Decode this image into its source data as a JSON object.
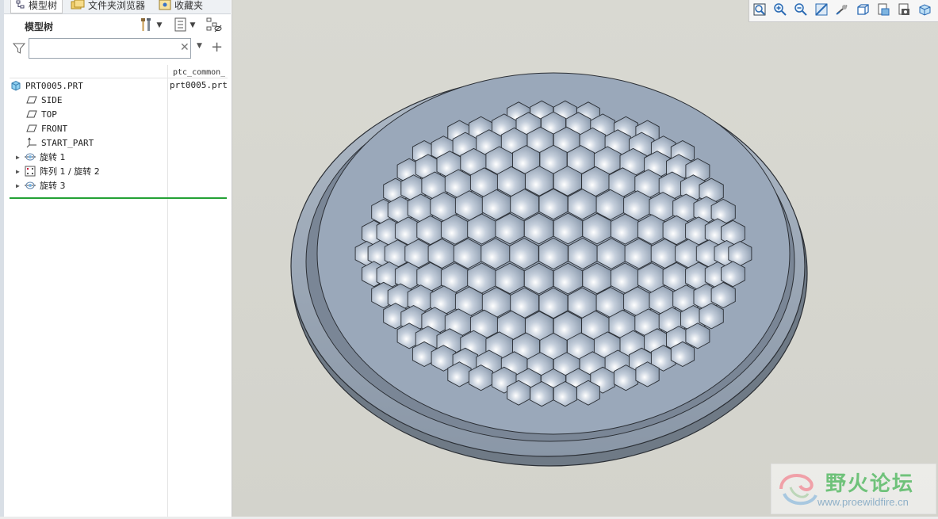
{
  "tabs": [
    {
      "label": "模型树"
    },
    {
      "label": "文件夹浏览器"
    },
    {
      "label": "收藏夹"
    }
  ],
  "panel": {
    "title": "模型树"
  },
  "search": {
    "value": "",
    "placeholder": ""
  },
  "tree": {
    "column_header": "ptc_common_name",
    "root": {
      "label": "PRT0005.PRT",
      "column_value": "prt0005.prt"
    },
    "items": [
      {
        "label": "SIDE",
        "icon": "datum-plane-icon"
      },
      {
        "label": "TOP",
        "icon": "datum-plane-icon"
      },
      {
        "label": "FRONT",
        "icon": "datum-plane-icon"
      },
      {
        "label": "START_PART",
        "icon": "coordinate-system-icon"
      },
      {
        "label": "旋转 1",
        "icon": "revolve-icon"
      },
      {
        "label": "阵列 1 / 旋转 2",
        "icon": "pattern-icon"
      },
      {
        "label": "旋转 3",
        "icon": "revolve-icon"
      }
    ]
  },
  "view_toolbar": {
    "buttons": [
      "refit-icon",
      "zoom-in-icon",
      "zoom-out-icon",
      "repaint-icon",
      "orientation-icon",
      "saved-views-icon",
      "display-style-icon",
      "view-manager-icon",
      "perspective-icon"
    ]
  },
  "watermark": {
    "title": "野火论坛",
    "url": "www.proewildfire.cn"
  },
  "colors": {
    "model_face": "#a9b7c8",
    "model_edge": "#2b2f35",
    "background": "#d6d6cf",
    "tree_insert_line": "#23a135"
  }
}
